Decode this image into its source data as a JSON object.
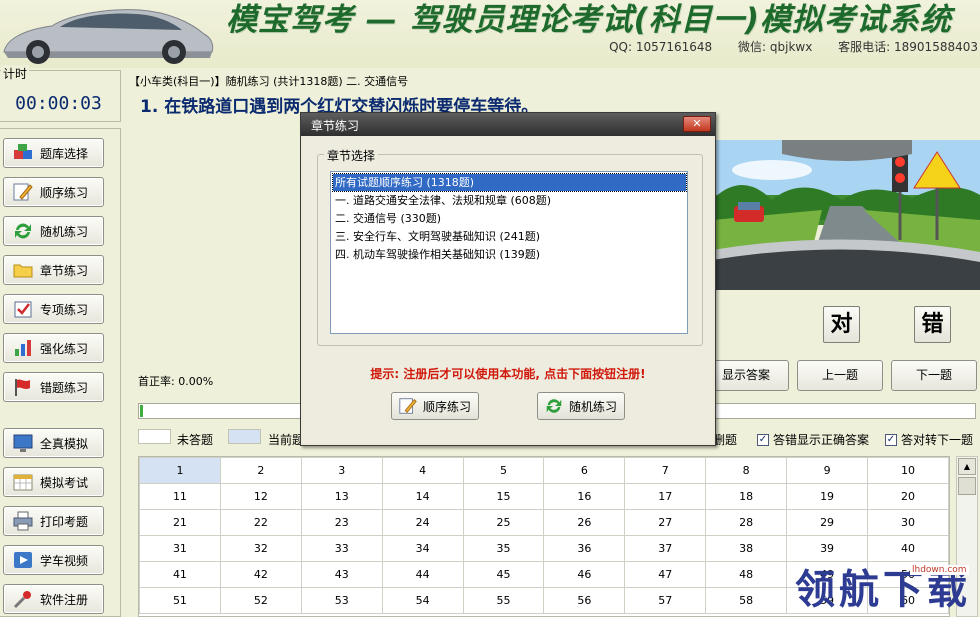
{
  "header": {
    "app_title": "模宝驾考 — 驾驶员理论考试(科目一)模拟考试系统",
    "qq": "QQ: 1057161648",
    "wechat": "微信: qbjkwx",
    "service_phone": "客服电话: 18901588403"
  },
  "timer": {
    "caption": "计时",
    "value": "00:00:03"
  },
  "nav": [
    {
      "label": "题库选择",
      "icon": "database-icon"
    },
    {
      "label": "顺序练习",
      "icon": "pencil-icon"
    },
    {
      "label": "随机练习",
      "icon": "refresh-icon"
    },
    {
      "label": "章节练习",
      "icon": "folder-icon"
    },
    {
      "label": "专项练习",
      "icon": "checkbox-icon"
    },
    {
      "label": "强化练习",
      "icon": "bar-chart-icon"
    },
    {
      "label": "错题练习",
      "icon": "flag-icon"
    },
    {
      "label": "全真模拟",
      "icon": "monitor-icon"
    },
    {
      "label": "模拟考试",
      "icon": "calendar-icon"
    },
    {
      "label": "打印考题",
      "icon": "printer-icon"
    },
    {
      "label": "学车视频",
      "icon": "video-icon"
    },
    {
      "label": "软件注册",
      "icon": "tool-icon"
    }
  ],
  "question": {
    "breadcrumb": "【小车类(科目一)】随机练习 (共计1318题) 二. 交通信号",
    "text": "1. 在铁路道口遇到两个红灯交替闪烁时要停车等待。"
  },
  "answer_buttons": {
    "correct": "对",
    "wrong": "错"
  },
  "controls": {
    "show_answer": "显示答案",
    "prev": "上一题",
    "next": "下一题"
  },
  "stats": {
    "accuracy": "首正率: 0.00%",
    "progress_fraction": 0.003
  },
  "legend": {
    "unanswered": "未答题",
    "current": "当前题"
  },
  "options": {
    "partial_label": "删题",
    "show_correct": "答错显示正确答案",
    "auto_next": "答对转下一题"
  },
  "grid": {
    "rows": [
      [
        "1",
        "2",
        "3",
        "4",
        "5",
        "6",
        "7",
        "8",
        "9",
        "10"
      ],
      [
        "11",
        "12",
        "13",
        "14",
        "15",
        "16",
        "17",
        "18",
        "19",
        "20"
      ],
      [
        "21",
        "22",
        "23",
        "24",
        "25",
        "26",
        "27",
        "28",
        "29",
        "30"
      ],
      [
        "31",
        "32",
        "33",
        "34",
        "35",
        "36",
        "37",
        "38",
        "39",
        "40"
      ],
      [
        "41",
        "42",
        "43",
        "44",
        "45",
        "46",
        "47",
        "48",
        "49",
        "50"
      ],
      [
        "51",
        "52",
        "53",
        "54",
        "55",
        "56",
        "57",
        "58",
        "59",
        "60"
      ]
    ],
    "current": "1"
  },
  "watermark": {
    "text": "领航下载",
    "url": "lhdown.com"
  },
  "dialog": {
    "title": "章节练习",
    "group_caption": "章节选择",
    "chapters": [
      "所有试题顺序练习 (1318题)",
      "一. 道路交通安全法律、法规和规章 (608题)",
      "二. 交通信号 (330题)",
      "三. 安全行车、文明驾驶基础知识 (241题)",
      "四. 机动车驾驶操作相关基础知识 (139题)"
    ],
    "selected_index": 0,
    "tip": "提示: 注册后才可以使用本功能, 点击下面按钮注册!",
    "btn_sequential": "顺序练习",
    "btn_random": "随机练习"
  },
  "colors": {
    "background": "#eef0d9",
    "question_text": "#0b2a6f",
    "tip_red": "#d0190b",
    "title_green": "#1d6a2c",
    "selection_blue": "#316ac5"
  }
}
